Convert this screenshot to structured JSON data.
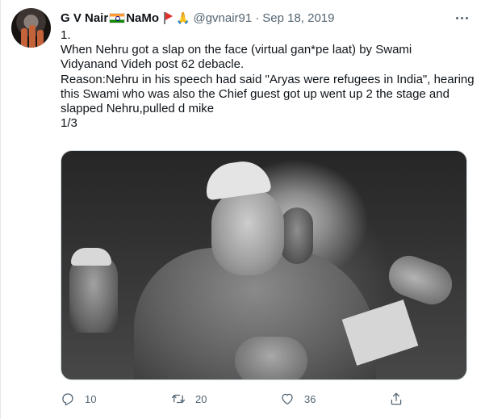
{
  "author": {
    "name": "G V Nair",
    "name_suffix": "NaMo",
    "handle": "@gvnair91",
    "separator": "·",
    "date": "Sep 18, 2019"
  },
  "tweet": {
    "lines": [
      "1.",
      "When Nehru got a slap on the face (virtual gan*pe laat) by Swami",
      "Vidyanand Videh post 62 debacle.",
      "Reason:Nehru in his speech had said \"Aryas were refugees in India\", hearing",
      "this Swami who was also the Chief guest got up went up 2 the stage and",
      "slapped Nehru,pulled d mike",
      "1/3"
    ]
  },
  "icons": {
    "reply": "reply-icon",
    "retweet": "retweet-icon",
    "like": "heart-icon",
    "share": "share-icon",
    "more": "more-icon"
  },
  "actions": {
    "reply_count": "10",
    "retweet_count": "20",
    "like_count": "36"
  },
  "colors": {
    "text": "#0f1419",
    "secondary": "#536471",
    "border": "#cfd9de"
  }
}
